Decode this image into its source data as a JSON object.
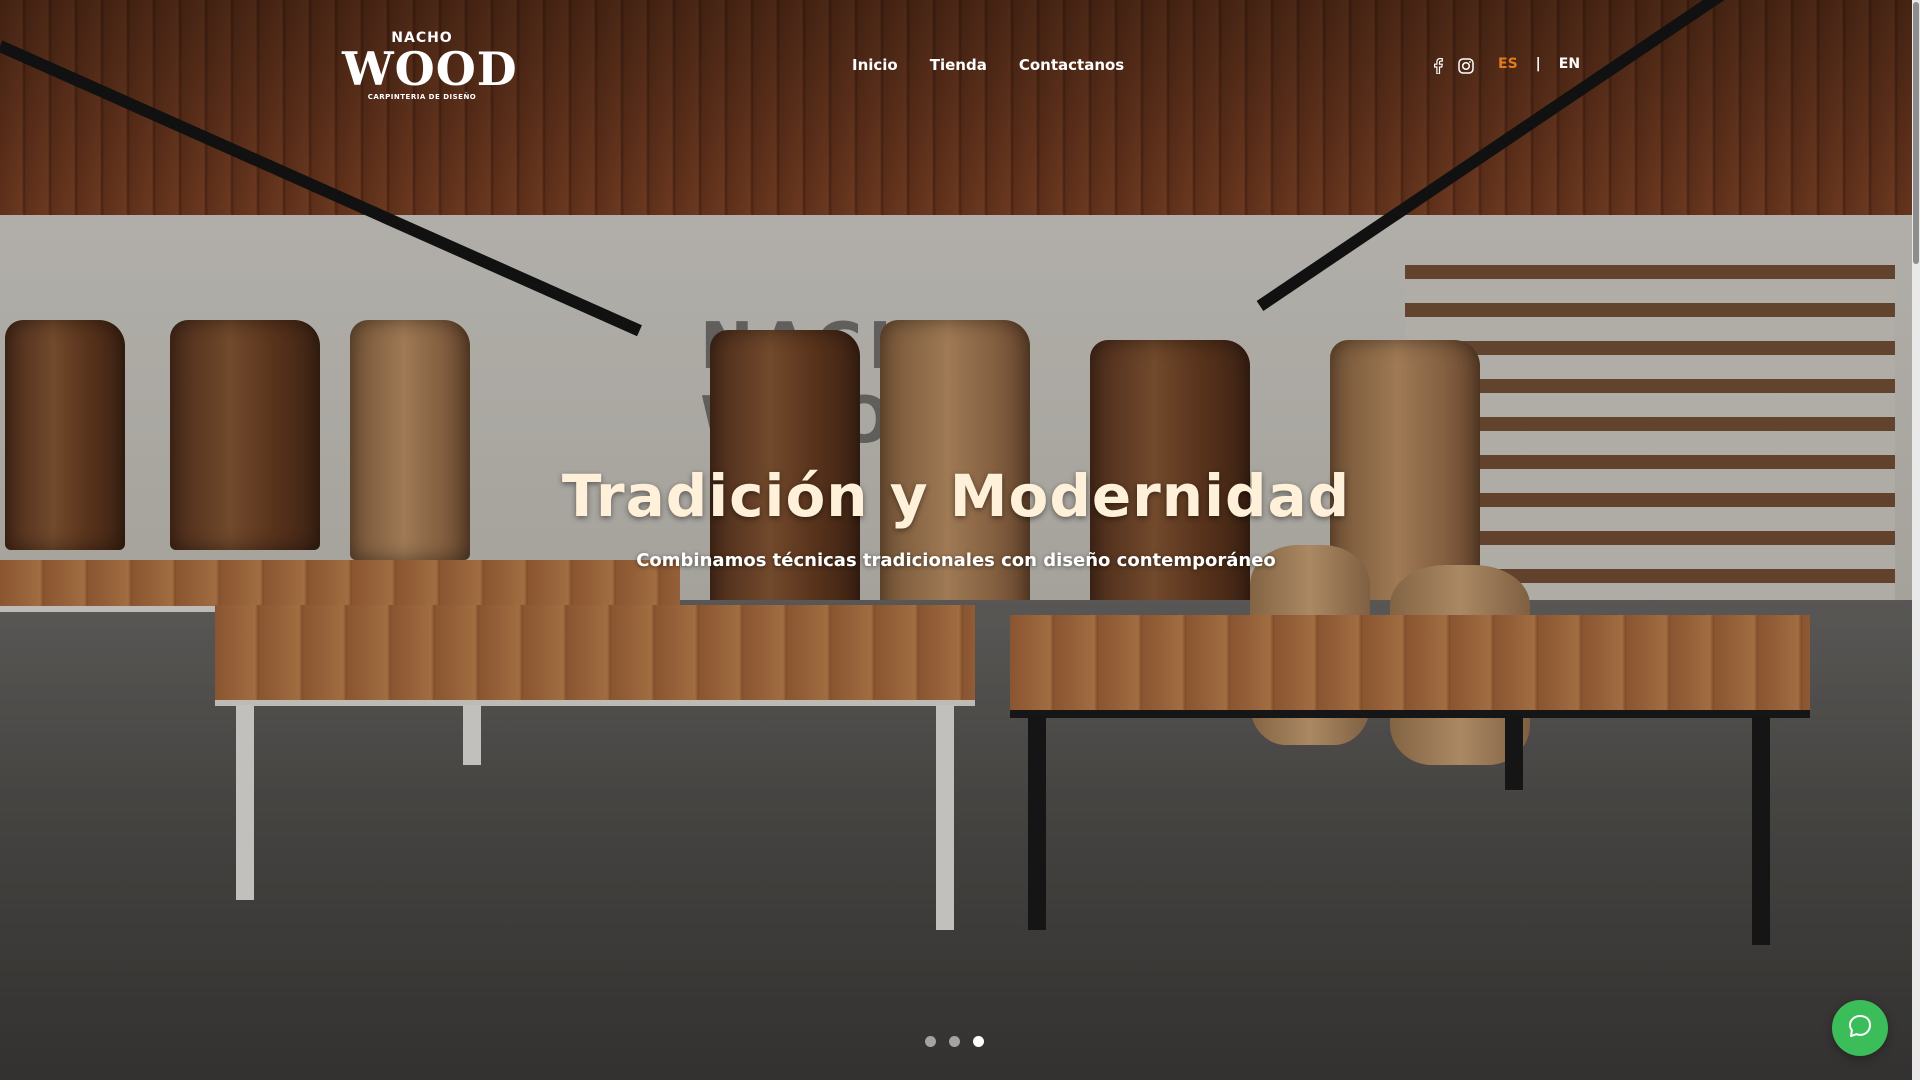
{
  "brand": {
    "logo_top": "NACHO",
    "logo_main": "WOOD",
    "logo_sub": "CARPINTERIA DE DISEÑO"
  },
  "nav": {
    "items": [
      "Inicio",
      "Tienda",
      "Contactanos"
    ]
  },
  "social": {
    "icons": [
      "facebook-icon",
      "instagram-icon"
    ]
  },
  "language": {
    "active": "ES",
    "separator": "|",
    "other": "EN"
  },
  "hero": {
    "headline": "Tradición y Modernidad",
    "subheadline": "Combinamos técnicas tradicionales con diseño contemporáneo",
    "wall_sign": "NACHO WOOD"
  },
  "carousel": {
    "slide_count": 3,
    "active_slide": 3
  },
  "chat": {
    "icon": "chat-bubble-icon",
    "color": "#3bbd5a"
  },
  "colors": {
    "accent": "#e07a1e",
    "headline": "#fff1d9"
  }
}
